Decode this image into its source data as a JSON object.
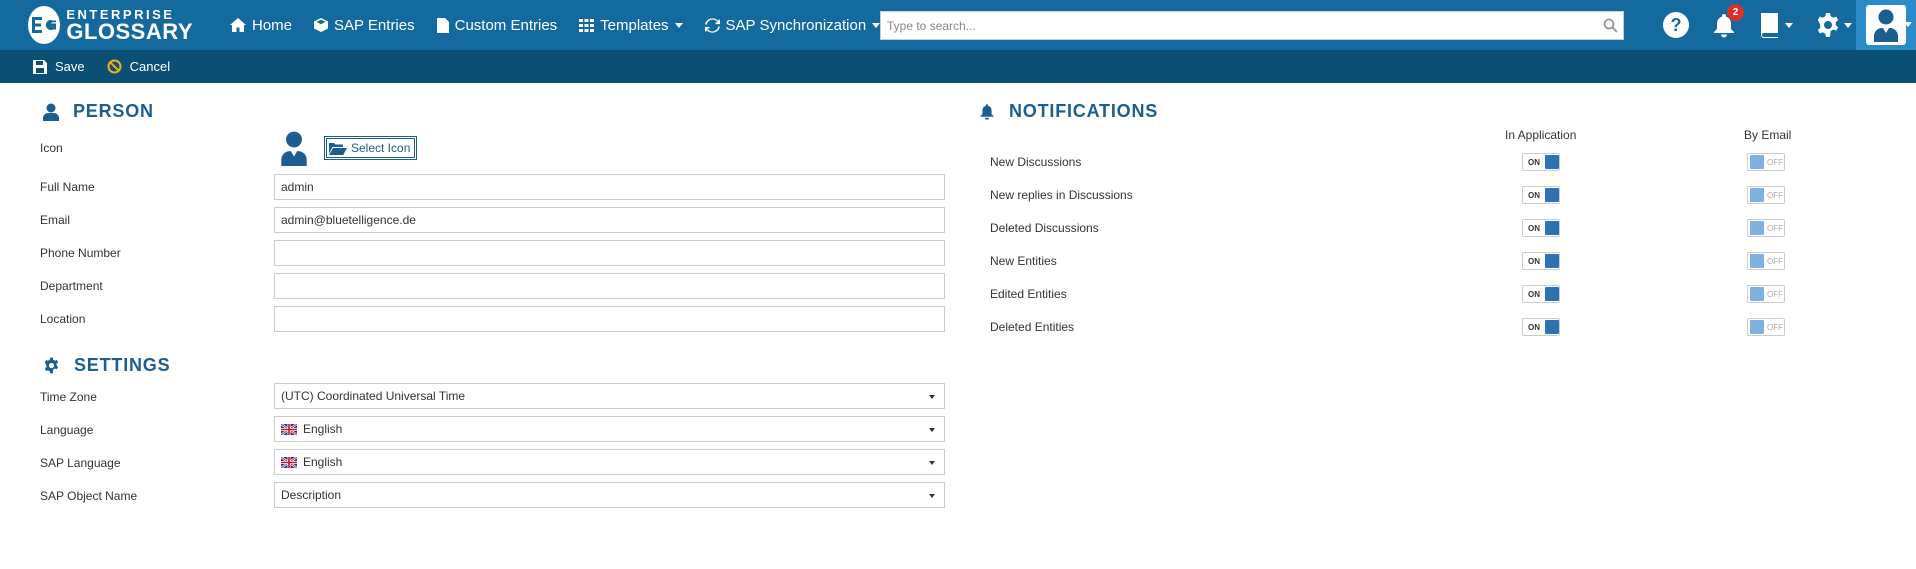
{
  "brand": {
    "line1": "ENTERPRISE",
    "line2": "GLOSSARY"
  },
  "nav": [
    {
      "label": "Home",
      "icon": "home-icon"
    },
    {
      "label": "SAP Entries",
      "icon": "cube-icon"
    },
    {
      "label": "Custom Entries",
      "icon": "file-icon"
    },
    {
      "label": "Templates",
      "icon": "grid-icon",
      "dropdown": true
    },
    {
      "label": "SAP Synchronization",
      "icon": "sync-icon",
      "dropdown": true
    }
  ],
  "search": {
    "placeholder": "Type to search...",
    "value": ""
  },
  "notifications_badge": "2",
  "toolbar": {
    "save_label": "Save",
    "cancel_label": "Cancel"
  },
  "person": {
    "title": "PERSON",
    "icon_label": "Icon",
    "select_icon_label": "Select Icon",
    "fields": {
      "full_name": {
        "label": "Full Name",
        "value": "admin"
      },
      "email": {
        "label": "Email",
        "value": "admin@bluetelligence.de"
      },
      "phone": {
        "label": "Phone Number",
        "value": ""
      },
      "department": {
        "label": "Department",
        "value": ""
      },
      "location": {
        "label": "Location",
        "value": ""
      }
    }
  },
  "settings": {
    "title": "SETTINGS",
    "time_zone": {
      "label": "Time Zone",
      "value": "(UTC) Coordinated Universal Time"
    },
    "language": {
      "label": "Language",
      "value": "English"
    },
    "sap_language": {
      "label": "SAP Language",
      "value": "English"
    },
    "sap_object_name": {
      "label": "SAP Object Name",
      "value": "Description"
    }
  },
  "notifications": {
    "title": "NOTIFICATIONS",
    "col_app": "In Application",
    "col_email": "By Email",
    "on_text": "ON",
    "off_text": "OFF",
    "rows": [
      {
        "label": "New Discussions",
        "app": true,
        "email": false
      },
      {
        "label": "New replies in Discussions",
        "app": true,
        "email": false
      },
      {
        "label": "Deleted Discussions",
        "app": true,
        "email": false
      },
      {
        "label": "New Entities",
        "app": true,
        "email": false
      },
      {
        "label": "Edited Entities",
        "app": true,
        "email": false
      },
      {
        "label": "Deleted Entities",
        "app": true,
        "email": false
      }
    ]
  },
  "colors": {
    "topbar": "#14699e",
    "actionbar": "#0b4f75",
    "accent": "#1c5e8f",
    "toggle_on": "#2d72b3",
    "toggle_off": "#7fb1e0",
    "badge": "#d9302a"
  }
}
